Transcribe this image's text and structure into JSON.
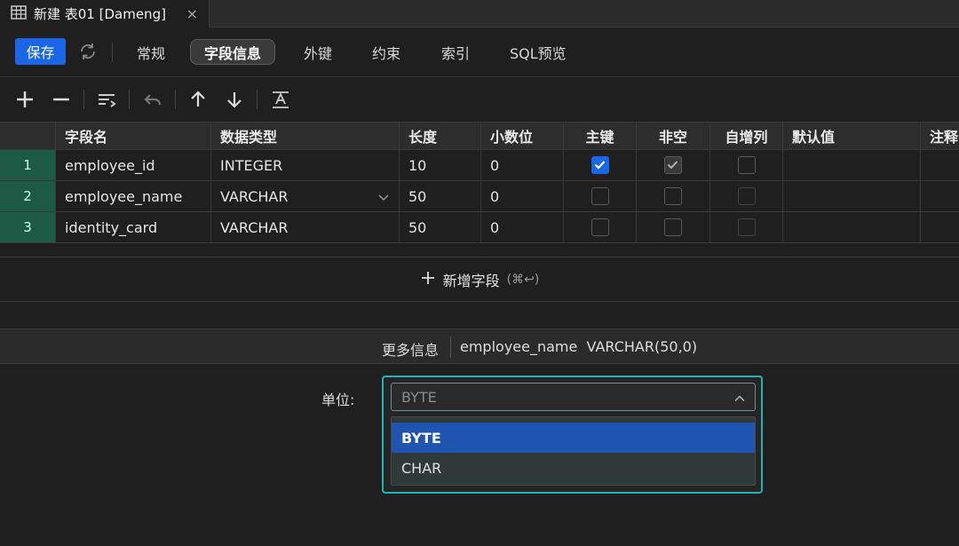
{
  "tab": {
    "title": "新建 表01 [Dameng]",
    "close": "×"
  },
  "toolbar": {
    "save": "保存",
    "tabs": [
      "常规",
      "字段信息",
      "外键",
      "约束",
      "索引",
      "SQL预览"
    ],
    "active_tab": "字段信息"
  },
  "grid": {
    "columns": [
      "字段名",
      "数据类型",
      "长度",
      "小数位",
      "主键",
      "非空",
      "自增列",
      "默认值",
      "注释"
    ],
    "rows": [
      {
        "num": "1",
        "name": "employee_id",
        "type": "INTEGER",
        "length": "10",
        "scale": "0",
        "pk": true,
        "notnull": true,
        "auto": false
      },
      {
        "num": "2",
        "name": "employee_name",
        "type": "VARCHAR",
        "length": "50",
        "scale": "0",
        "pk": false,
        "notnull": false,
        "auto": false
      },
      {
        "num": "3",
        "name": "identity_card",
        "type": "VARCHAR",
        "length": "50",
        "scale": "0",
        "pk": false,
        "notnull": false,
        "auto": false
      }
    ]
  },
  "add_field": {
    "label": "新增字段",
    "shortcut": "(⌘↩)"
  },
  "info": {
    "label": "更多信息",
    "value": "employee_name  VARCHAR(50,0)"
  },
  "unit": {
    "label": "单位:",
    "selected": "BYTE",
    "options": [
      "BYTE",
      "CHAR"
    ]
  },
  "colors": {
    "accent": "#1a66e6",
    "focus": "#1fb5b5",
    "rownum": "#1d5a46"
  }
}
